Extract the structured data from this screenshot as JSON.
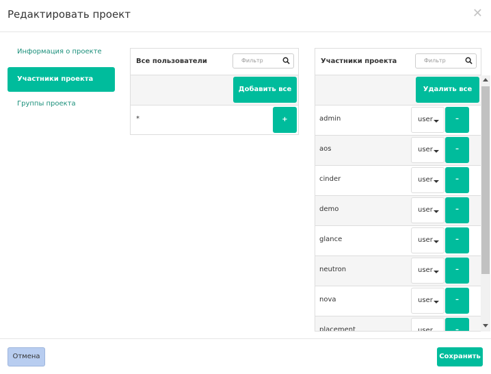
{
  "modal": {
    "title": "Редактировать проект",
    "close_symbol": "✕"
  },
  "nav": {
    "items": [
      {
        "label": "Информация о проекте",
        "active": false
      },
      {
        "label": "Участники проекта",
        "active": true
      },
      {
        "label": "Группы проекта",
        "active": false
      }
    ]
  },
  "all_users": {
    "title": "Все пользователи",
    "filter_placeholder": "Фильтр",
    "add_all_label": "Добавить все",
    "rows": [
      {
        "name": "*",
        "button": "+"
      }
    ]
  },
  "members": {
    "title": "Участники проекта",
    "filter_placeholder": "Фильтр",
    "remove_all_label": "Удалить все",
    "rows": [
      {
        "name": "admin",
        "role": "user",
        "button": "–"
      },
      {
        "name": "aos",
        "role": "user",
        "button": "–"
      },
      {
        "name": "cinder",
        "role": "user",
        "button": "–"
      },
      {
        "name": "demo",
        "role": "user",
        "button": "–"
      },
      {
        "name": "glance",
        "role": "user",
        "button": "–"
      },
      {
        "name": "neutron",
        "role": "user",
        "button": "–"
      },
      {
        "name": "nova",
        "role": "user",
        "button": "–"
      },
      {
        "name": "placement",
        "role": "user",
        "button": "–"
      }
    ]
  },
  "footer": {
    "cancel_label": "Отмена",
    "save_label": "Сохранить"
  },
  "colors": {
    "accent": "#00bc9c",
    "cancel_bg": "#b8cdf0",
    "nav_text": "#1a8f7a"
  }
}
